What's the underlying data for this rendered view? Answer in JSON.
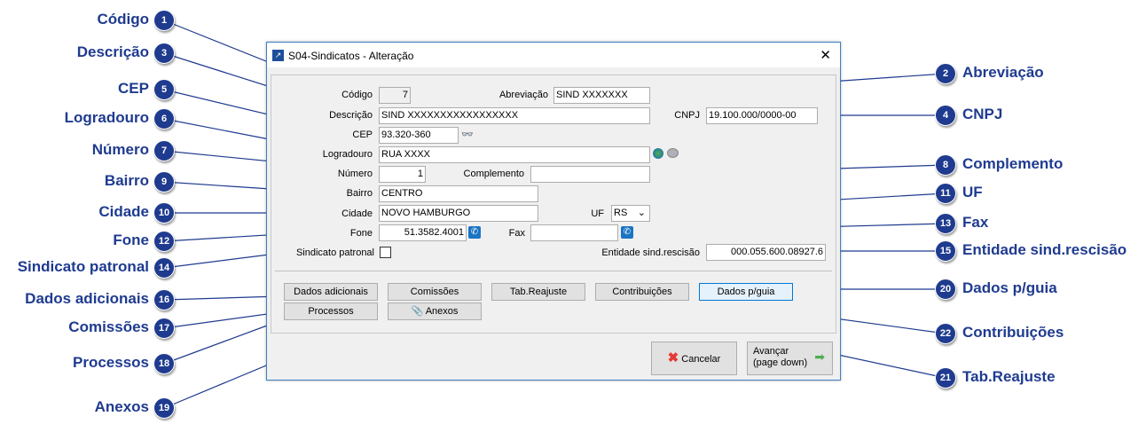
{
  "window": {
    "title": "S04-Sindicatos - Alteração",
    "close": "✕"
  },
  "form": {
    "codigo_label": "Código",
    "codigo": "7",
    "abreviacao_label": "Abreviação",
    "abreviacao": "SIND XXXXXXX",
    "descricao_label": "Descrição",
    "descricao": "SIND XXXXXXXXXXXXXXXXX",
    "cnpj_label": "CNPJ",
    "cnpj": "19.100.000/0000-00",
    "cep_label": "CEP",
    "cep": "93.320-360",
    "logradouro_label": "Logradouro",
    "logradouro": "RUA XXXX",
    "numero_label": "Número",
    "numero": "1",
    "complemento_label": "Complemento",
    "complemento": "",
    "bairro_label": "Bairro",
    "bairro": "CENTRO",
    "cidade_label": "Cidade",
    "cidade": "NOVO HAMBURGO",
    "uf_label": "UF",
    "uf": "RS",
    "fone_label": "Fone",
    "fone": "51.3582.4001",
    "fax_label": "Fax",
    "fax": "",
    "sindicato_patronal_label": "Sindicato patronal",
    "sindicato_patronal": false,
    "entidade_label": "Entidade sind.rescisão",
    "entidade": "000.055.600.08927.6"
  },
  "buttons": {
    "dados_adicionais": "Dados adicionais",
    "comissoes": "Comissões",
    "tab_reajuste": "Tab.Reajuste",
    "contribuicoes": "Contribuições",
    "dados_guia": "Dados p/guia",
    "processos": "Processos",
    "anexos": "Anexos",
    "cancelar": "Cancelar",
    "avancar": "Avançar",
    "avancar_sub": "(page down)"
  },
  "callouts": [
    {
      "n": "1",
      "text": "Código"
    },
    {
      "n": "3",
      "text": "Descrição"
    },
    {
      "n": "5",
      "text": "CEP"
    },
    {
      "n": "6",
      "text": "Logradouro"
    },
    {
      "n": "7",
      "text": "Número"
    },
    {
      "n": "9",
      "text": "Bairro"
    },
    {
      "n": "10",
      "text": "Cidade"
    },
    {
      "n": "12",
      "text": "Fone"
    },
    {
      "n": "14",
      "text": "Sindicato patronal"
    },
    {
      "n": "16",
      "text": "Dados adicionais"
    },
    {
      "n": "17",
      "text": "Comissões"
    },
    {
      "n": "18",
      "text": "Processos"
    },
    {
      "n": "19",
      "text": "Anexos"
    },
    {
      "n": "2",
      "text": "Abreviação"
    },
    {
      "n": "4",
      "text": "CNPJ"
    },
    {
      "n": "8",
      "text": "Complemento"
    },
    {
      "n": "11",
      "text": "UF"
    },
    {
      "n": "13",
      "text": "Fax"
    },
    {
      "n": "15",
      "text": "Entidade sind.rescisão"
    },
    {
      "n": "20",
      "text": "Dados p/guia"
    },
    {
      "n": "22",
      "text": "Contribuições"
    },
    {
      "n": "21",
      "text": "Tab.Reajuste"
    }
  ],
  "colors": {
    "callout": "#1f3b8f",
    "phone_icon": "#1a74c4",
    "focus_button": "#e5f1fb"
  }
}
